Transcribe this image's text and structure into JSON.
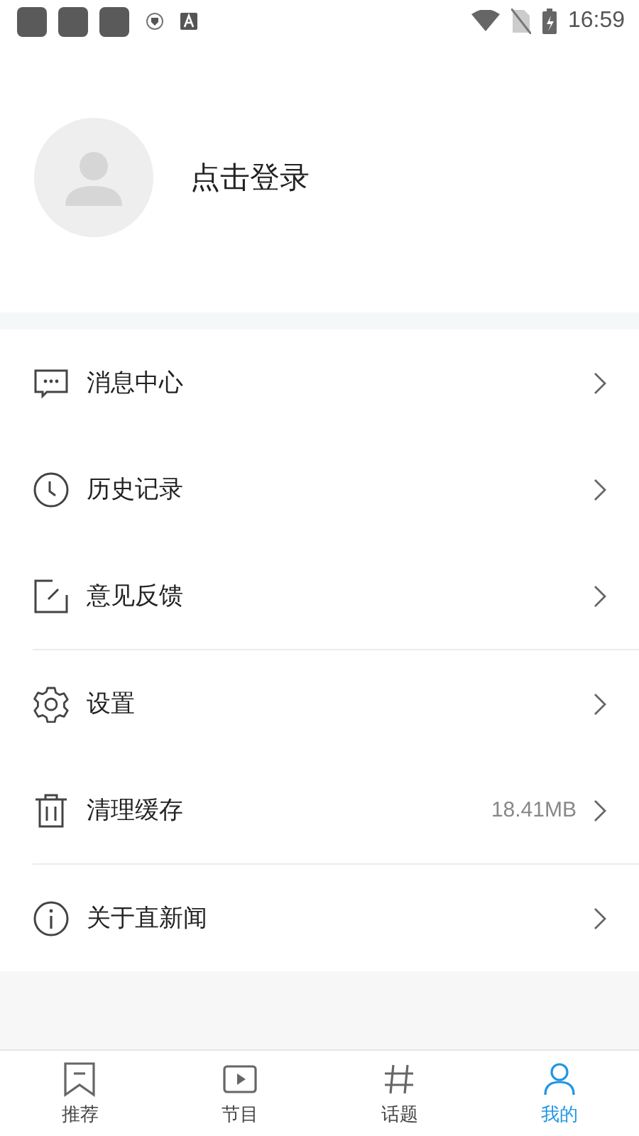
{
  "status_bar": {
    "time": "16:59"
  },
  "profile": {
    "login_text": "点击登录"
  },
  "menu_groups": [
    [
      {
        "kind": "message",
        "label": "消息中心"
      },
      {
        "kind": "history",
        "label": "历史记录"
      },
      {
        "kind": "feedback",
        "label": "意见反馈"
      }
    ],
    [
      {
        "kind": "settings",
        "label": "设置"
      },
      {
        "kind": "cache",
        "label": "清理缓存",
        "value": "18.41MB"
      }
    ],
    [
      {
        "kind": "about",
        "label": "关于直新闻"
      }
    ]
  ],
  "tabs": [
    {
      "label": "推荐",
      "selected": false
    },
    {
      "label": "节目",
      "selected": false
    },
    {
      "label": "话题",
      "selected": false
    },
    {
      "label": "我的",
      "selected": true
    }
  ]
}
